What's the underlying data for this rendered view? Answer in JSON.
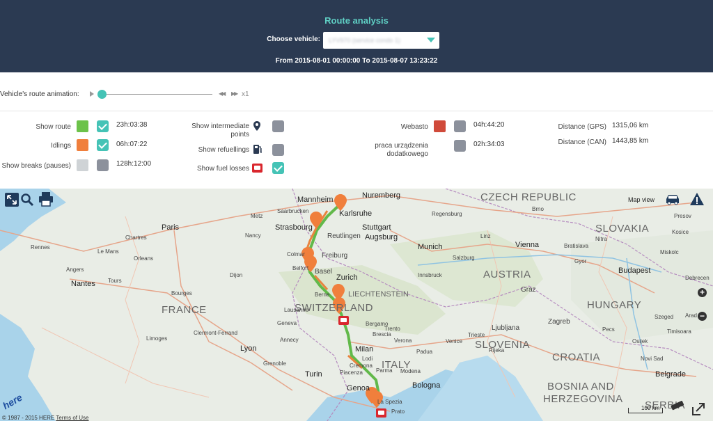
{
  "header": {
    "title": "Route analysis",
    "vehicle_label": "Choose vehicle:",
    "vehicle_value": "LYV970 (service condo 1)",
    "range": "From 2015-08-01 00:00:00 To 2015-08-07 13:23:22"
  },
  "animation": {
    "label": "Vehicle's route animation:",
    "position": 0.0,
    "speed": "x1"
  },
  "options": {
    "route": {
      "label": "Show route",
      "color": "#6cc24a",
      "checked": true,
      "value": "23h:03:38"
    },
    "idlings": {
      "label": "Idlings",
      "color": "#f07f3c",
      "checked": true,
      "value": "06h:07:22"
    },
    "breaks": {
      "label": "Show breaks (pauses)",
      "color": "#cfd3d6",
      "checked": false,
      "value": "128h:12:00"
    },
    "intermediate": {
      "label_1": "Show intermediate",
      "label_2": "points",
      "icon": "map-pin-icon",
      "checked": false
    },
    "refuellings": {
      "label": "Show refuellings",
      "icon": "fuel-pump-icon",
      "checked": false
    },
    "fuel_losses": {
      "label": "Show fuel losses",
      "icon": "fuel-loss-icon",
      "checked": true
    },
    "webasto": {
      "label": "Webasto",
      "color": "#d04a3a",
      "checked": false,
      "value": "04h:44:20"
    },
    "aux": {
      "label_1": "praca urządzenia",
      "label_2": "dodatkowego",
      "checked": false,
      "value": "02h:34:03"
    },
    "distance_gps": {
      "label": "Distance (GPS)",
      "value": "1315,06 km"
    },
    "distance_can": {
      "label": "Distance (CAN)",
      "value": "1443,85 km"
    }
  },
  "map": {
    "map_view_label": "Map view",
    "countries": [
      "CZECH REPUBLIC",
      "SLOVAKIA",
      "AUSTRIA",
      "HUNGARY",
      "FRANCE",
      "SWITZERLAND",
      "LIECHTENSTEIN",
      "ITALY",
      "SLOVENIA",
      "CROATIA",
      "BOSNIA AND",
      "HERZEGOVINA",
      "SERBIA"
    ],
    "cities": [
      "Mannheim",
      "Nuremberg",
      "Karlsruhe",
      "Saarbrucken",
      "Strasbourg",
      "Stuttgart",
      "Reutlingen",
      "Augsburg",
      "Regensburg",
      "Munich",
      "Vienna",
      "Bratislava",
      "Brno",
      "Budapest",
      "Paris",
      "Orleans",
      "Nantes",
      "Tours",
      "Limoges",
      "Clermont-Ferrand",
      "Lyon",
      "Geneva",
      "Berne",
      "Zurich",
      "Basel",
      "Freiburg",
      "Colmar",
      "Belfort",
      "Milan",
      "Turin",
      "Genoa",
      "Bologna",
      "Ljubljana",
      "Zagreb",
      "Graz",
      "Venice",
      "Padua",
      "Verona",
      "Trento",
      "Parma",
      "Modena",
      "Cremona",
      "Piacenza",
      "Lodi",
      "La Spezia",
      "Prato",
      "Belgrade",
      "Novi Sad",
      "Rennes",
      "Angers",
      "Chartres",
      "Le Mans",
      "Dijon",
      "Bourges",
      "Nancy",
      "Metz",
      "Grenoble",
      "Annecy",
      "Lausanne",
      "Innsbruck",
      "Linz",
      "Salzburg",
      "Brescia",
      "Bergamo",
      "Trieste",
      "Rijeka",
      "Osijek",
      "Pecs",
      "Szeged",
      "Gyor",
      "Nitra",
      "Presov",
      "Kosice",
      "Miskolc",
      "Debrecen",
      "Arad",
      "Timisoara"
    ],
    "copyright": "© 1987 - 2015 HERE",
    "terms": "Terms of Use",
    "scale": "100 km",
    "here_logo": "here"
  }
}
